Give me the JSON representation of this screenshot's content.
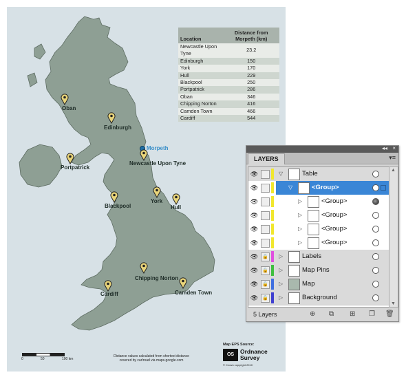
{
  "table": {
    "col_location": "Location",
    "col_distance": "Distance from Morpeth (km)",
    "rows": [
      {
        "location": "Newcastle Upon Tyne",
        "distance": "23.2"
      },
      {
        "location": "Edinburgh",
        "distance": "150"
      },
      {
        "location": "York",
        "distance": "170"
      },
      {
        "location": "Hull",
        "distance": "229"
      },
      {
        "location": "Blackpool",
        "distance": "250"
      },
      {
        "location": "Portpatrick",
        "distance": "286"
      },
      {
        "location": "Oban",
        "distance": "346"
      },
      {
        "location": "Chipping Norton",
        "distance": "416"
      },
      {
        "location": "Camden Town",
        "distance": "466"
      },
      {
        "location": "Cardiff",
        "distance": "544"
      }
    ]
  },
  "map_labels": {
    "oban": "Oban",
    "edinburgh": "Edinburgh",
    "morpeth": "Morpeth",
    "newcastle": "Newcastle Upon Tyne",
    "portpatrick": "Portpatrick",
    "york": "York",
    "blackpool": "Blackpool",
    "hull": "Hull",
    "chipping_norton": "Chipping Norton",
    "cardiff": "Cardiff",
    "camden_town": "Camden Town"
  },
  "footer": {
    "scale_0": "0",
    "scale_50": "50",
    "scale_100": "100 km",
    "note": "Distance values calculated from shortest distance covered by car/road via maps.google.com",
    "source": "Map EPS Source:",
    "os_logo": "OS",
    "os_name_1": "Ordnance",
    "os_name_2": "Survey",
    "copyright": "© Crown copyright 2010"
  },
  "layers_panel": {
    "tab": "LAYERS",
    "collapse": "◂◂",
    "close": "×",
    "menu": "▾≡",
    "count": "5 Layers",
    "layers": [
      {
        "name": "Table",
        "color": "#f1e72d"
      },
      {
        "name": "<Group>",
        "color": "#f1e72d"
      },
      {
        "name": "<Group>",
        "color": "#f1e72d"
      },
      {
        "name": "<Group>",
        "color": "#f1e72d"
      },
      {
        "name": "<Group>",
        "color": "#f1e72d"
      },
      {
        "name": "<Group>",
        "color": "#f1e72d"
      },
      {
        "name": "Labels",
        "color": "#e04fe0"
      },
      {
        "name": "Map Pins",
        "color": "#3fbf3f"
      },
      {
        "name": "Map",
        "color": "#3f6fe0"
      },
      {
        "name": "Background",
        "color": "#3f3fd0"
      }
    ]
  },
  "colors": {
    "land": "#8e9f94",
    "sea": "#d7e1e6",
    "pin": "#e8d47a",
    "selection": "#3a86d6"
  }
}
